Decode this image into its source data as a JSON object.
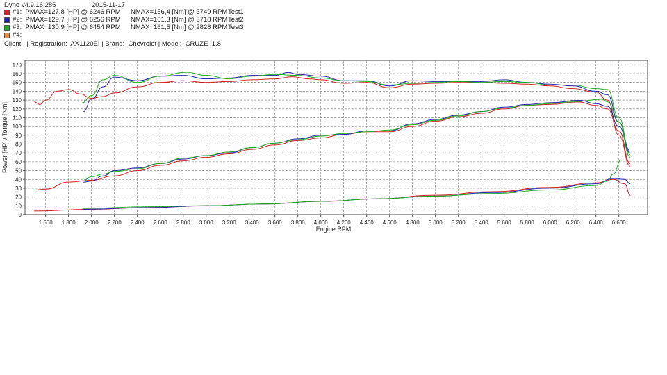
{
  "header": {
    "app_version": "Dyno v4.9.16.285",
    "date": "2015-11-17",
    "client_line": "Client:  | Registration:  AX1120EI | Brand:  Chevrolet | Model:  CRUZE_1.8"
  },
  "legend": [
    {
      "label": "#1:  PMAX=127,8 [HP] @ 6246 RPM",
      "nmax": "NMAX=156,4 [Nm] @ 3749 RPM",
      "test": "Test1",
      "color": "#cc2222"
    },
    {
      "label": "#2:  PMAX=129,7 [HP] @ 6256 RPM",
      "nmax": "NMAX=161,3 [Nm] @ 3718 RPM",
      "test": "Test2",
      "color": "#2222aa"
    },
    {
      "label": "#3:  PMAX=130,9 [HP] @ 6454 RPM",
      "nmax": "NMAX=161,5 [Nm] @ 2828 RPM",
      "test": "Test3",
      "color": "#22aa22"
    },
    {
      "label": "#4:",
      "nmax": "",
      "test": "",
      "color": "#e08a3a"
    }
  ],
  "chart_data": {
    "type": "line",
    "xlabel": "Engine RPM",
    "ylabel": "Power [HP] / Torque [Nm]",
    "xlim": [
      1420,
      6850
    ],
    "ylim": [
      0,
      175
    ],
    "x_ticks": [
      1600,
      1800,
      2000,
      2200,
      2400,
      2600,
      2800,
      3000,
      3200,
      3400,
      3600,
      3800,
      4000,
      4200,
      4400,
      4600,
      4800,
      5000,
      5200,
      5400,
      5600,
      5800,
      6000,
      6200,
      6400,
      6600
    ],
    "x_tick_labels": [
      "1.600",
      "1.800",
      "2.000",
      "2.200",
      "2.400",
      "2.600",
      "2.800",
      "3.000",
      "3.200",
      "3.400",
      "3.600",
      "3.800",
      "4.000",
      "4.200",
      "4.400",
      "4.600",
      "4.800",
      "5.000",
      "5.200",
      "5.400",
      "5.600",
      "5.800",
      "6.000",
      "6.200",
      "6.400",
      "6.600"
    ],
    "y_ticks": [
      0,
      10,
      20,
      30,
      40,
      50,
      60,
      70,
      80,
      90,
      100,
      110,
      120,
      130,
      140,
      150,
      160,
      170
    ],
    "grid": true,
    "series": [
      {
        "name": "Test1",
        "kind": "torque",
        "color": "#cc2222",
        "x": [
          1500,
          1550,
          1600,
          1700,
          1800,
          1900,
          2000,
          2100,
          2200,
          2400,
          2600,
          2800,
          3000,
          3200,
          3400,
          3600,
          3749,
          3900,
          4000,
          4200,
          4400,
          4600,
          4800,
          5000,
          5200,
          5400,
          5600,
          5800,
          6000,
          6200,
          6400,
          6500,
          6600,
          6700
        ],
        "y": [
          128,
          125,
          130,
          140,
          142,
          137,
          132,
          134,
          138,
          145,
          150,
          152,
          150,
          151,
          153,
          154,
          156.4,
          154,
          153,
          149,
          150,
          144,
          148,
          149,
          150,
          150,
          149,
          148,
          146,
          143,
          139,
          130,
          90,
          55
        ]
      },
      {
        "name": "Test2",
        "kind": "torque",
        "color": "#2222aa",
        "x": [
          1930,
          2000,
          2100,
          2200,
          2400,
          2600,
          2800,
          3000,
          3200,
          3400,
          3600,
          3718,
          3800,
          4000,
          4200,
          4400,
          4600,
          4800,
          5000,
          5200,
          5400,
          5600,
          5800,
          6000,
          6200,
          6400,
          6500,
          6600,
          6700
        ],
        "y": [
          117,
          131,
          145,
          156,
          152,
          157,
          158,
          154,
          155,
          158,
          158,
          161.3,
          159,
          157,
          152,
          152,
          146,
          152,
          151,
          151,
          151,
          153,
          150,
          148,
          146,
          140,
          136,
          105,
          72
        ]
      },
      {
        "name": "Test3",
        "kind": "torque",
        "color": "#22aa22",
        "x": [
          1920,
          2000,
          2100,
          2200,
          2400,
          2600,
          2828,
          3000,
          3200,
          3400,
          3600,
          3800,
          4000,
          4200,
          4400,
          4600,
          4800,
          5000,
          5200,
          5400,
          5600,
          5800,
          6000,
          6200,
          6400,
          6500,
          6600,
          6700
        ],
        "y": [
          127,
          135,
          153,
          158,
          150,
          157,
          161.5,
          158,
          154,
          157,
          159,
          158,
          155,
          152,
          151,
          147,
          149,
          150,
          151,
          150,
          151,
          150,
          147,
          147,
          143,
          142,
          110,
          68
        ]
      },
      {
        "name": "Test1",
        "kind": "power",
        "color": "#cc2222",
        "x": [
          1500,
          1600,
          1800,
          2000,
          2200,
          2400,
          2600,
          2800,
          3000,
          3200,
          3400,
          3600,
          3800,
          4000,
          4200,
          4400,
          4600,
          4800,
          5000,
          5200,
          5400,
          5600,
          5800,
          6000,
          6246,
          6400,
          6500,
          6600,
          6700
        ],
        "y": [
          28,
          29,
          37,
          39,
          44,
          50,
          56,
          61,
          65,
          69,
          74,
          79,
          84,
          87,
          91,
          94,
          94,
          100,
          106,
          111,
          115,
          120,
          124,
          125,
          127.8,
          124,
          120,
          95,
          58
        ]
      },
      {
        "name": "Test2",
        "kind": "power",
        "color": "#2222aa",
        "x": [
          1930,
          2000,
          2100,
          2200,
          2400,
          2600,
          2800,
          3000,
          3200,
          3400,
          3600,
          3800,
          4000,
          4200,
          4400,
          4600,
          4800,
          5000,
          5200,
          5400,
          5600,
          5800,
          6000,
          6256,
          6400,
          6500,
          6600,
          6700
        ],
        "y": [
          37,
          38,
          44,
          50,
          53,
          58,
          63,
          67,
          70,
          76,
          81,
          86,
          90,
          91,
          95,
          95,
          103,
          108,
          113,
          117,
          122,
          125,
          127,
          129.7,
          126,
          123,
          100,
          70
        ]
      },
      {
        "name": "Test3",
        "kind": "power",
        "color": "#22aa22",
        "x": [
          1920,
          2000,
          2100,
          2200,
          2400,
          2600,
          2800,
          3000,
          3200,
          3400,
          3600,
          3800,
          4000,
          4200,
          4400,
          4600,
          4800,
          5000,
          5200,
          5400,
          5600,
          5800,
          6000,
          6200,
          6454,
          6500,
          6600,
          6700
        ],
        "y": [
          38,
          43,
          46,
          49,
          52,
          58,
          64,
          67,
          71,
          76,
          81,
          85,
          89,
          92,
          94,
          96,
          102,
          107,
          112,
          117,
          121,
          124,
          126,
          128,
          130.9,
          128,
          105,
          65
        ]
      },
      {
        "name": "Test1",
        "kind": "loss",
        "color": "#cc2222",
        "x": [
          1500,
          2000,
          2500,
          3000,
          3500,
          4000,
          4500,
          5000,
          5500,
          6000,
          6400,
          6550,
          6650,
          6700
        ],
        "y": [
          4,
          6,
          8,
          10,
          12,
          15,
          18,
          22,
          26,
          31,
          36,
          40,
          35,
          22
        ]
      },
      {
        "name": "Test2",
        "kind": "loss",
        "color": "#2222aa",
        "x": [
          1930,
          2500,
          3000,
          3500,
          4000,
          4500,
          5000,
          5500,
          6000,
          6400,
          6550,
          6650,
          6700
        ],
        "y": [
          6,
          8,
          10,
          12,
          15,
          18,
          21,
          25,
          30,
          35,
          41,
          40,
          35
        ]
      },
      {
        "name": "Test3",
        "kind": "loss",
        "color": "#22aa22",
        "x": [
          1920,
          2500,
          3000,
          3500,
          4000,
          4500,
          5000,
          5500,
          6000,
          6400,
          6500,
          6550,
          6620
        ],
        "y": [
          7,
          9,
          10,
          12,
          15,
          18,
          21,
          24,
          28,
          33,
          38,
          46,
          62
        ]
      }
    ]
  }
}
